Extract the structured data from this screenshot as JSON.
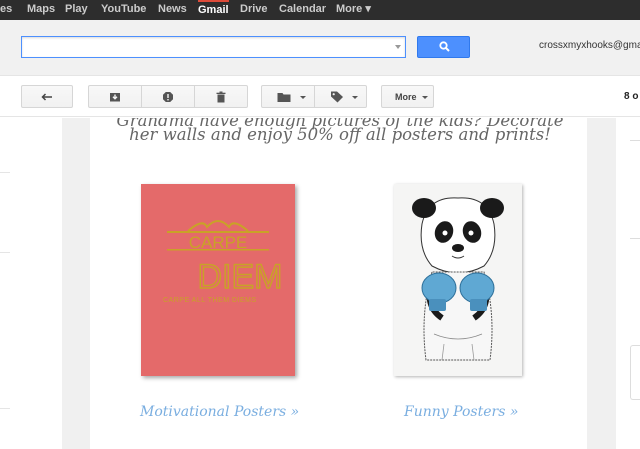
{
  "topnav": {
    "items": [
      {
        "label": "es",
        "active": false
      },
      {
        "label": "Maps",
        "active": false
      },
      {
        "label": "Play",
        "active": false
      },
      {
        "label": "YouTube",
        "active": false
      },
      {
        "label": "News",
        "active": false
      },
      {
        "label": "Gmail",
        "active": true
      },
      {
        "label": "Drive",
        "active": false
      },
      {
        "label": "Calendar",
        "active": false
      },
      {
        "label": "More ▾",
        "active": false
      }
    ]
  },
  "header": {
    "search_value": "",
    "account_email": "crossxmyxhooks@gma"
  },
  "toolbar": {
    "more_label": "More",
    "count_text": "8 o"
  },
  "email": {
    "promo_line1": "Grandma have enough pictures of the kids? Decorate",
    "promo_line2": "her walls and enjoy 50% off all posters and prints!",
    "poster1": {
      "title_top": "CARPE",
      "title_main": "DIEM",
      "subtitle": "CARPE ALL THEM DIEMS"
    },
    "link_motivational": "Motivational Posters »",
    "link_funny": "Funny Posters »"
  },
  "colors": {
    "accent_blue": "#4d90fe",
    "gmail_red": "#dd4b39",
    "poster_red": "#e46a6a",
    "poster_gold": "#c9a227",
    "glove_blue": "#5fa8d3",
    "link_blue": "#7aaee0"
  }
}
